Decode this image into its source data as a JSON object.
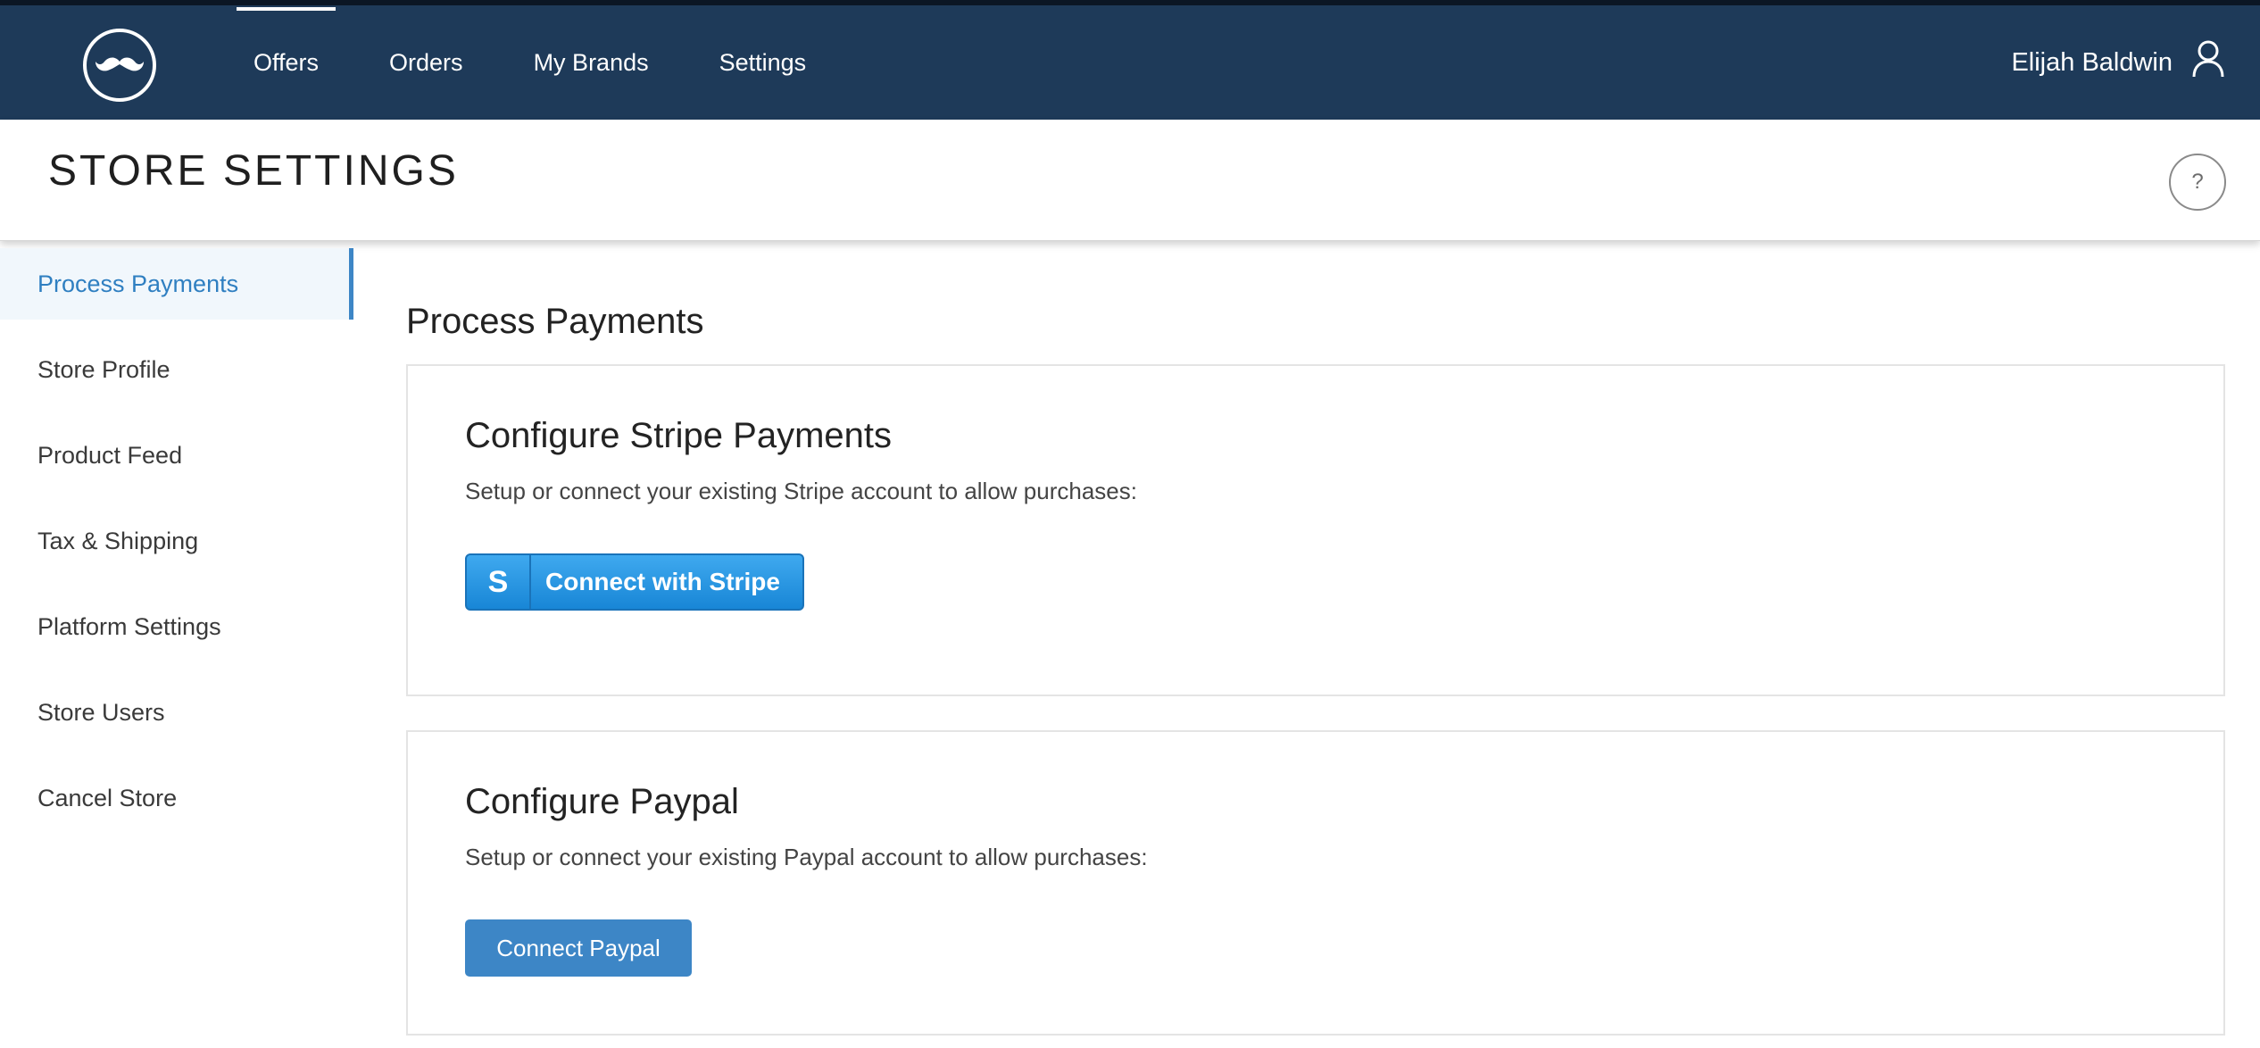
{
  "nav": {
    "items": [
      {
        "label": "Offers",
        "active": true
      },
      {
        "label": "Orders",
        "active": false
      },
      {
        "label": "My Brands",
        "active": false
      },
      {
        "label": "Settings",
        "active": false
      }
    ]
  },
  "user": {
    "name": "Elijah Baldwin"
  },
  "header": {
    "title": "STORE SETTINGS",
    "help": "?"
  },
  "sidebar": {
    "items": [
      {
        "label": "Process Payments",
        "active": true
      },
      {
        "label": "Store Profile",
        "active": false
      },
      {
        "label": "Product Feed",
        "active": false
      },
      {
        "label": "Tax & Shipping",
        "active": false
      },
      {
        "label": "Platform Settings",
        "active": false
      },
      {
        "label": "Store Users",
        "active": false
      },
      {
        "label": "Cancel Store",
        "active": false
      }
    ]
  },
  "main": {
    "title": "Process Payments",
    "stripe": {
      "heading": "Configure Stripe Payments",
      "description": "Setup or connect your existing Stripe account to allow purchases:",
      "button_icon": "S",
      "button_label": "Connect with Stripe"
    },
    "paypal": {
      "heading": "Configure Paypal",
      "description": "Setup or connect your existing Paypal account to allow purchases:",
      "button_label": "Connect Paypal"
    }
  },
  "colors": {
    "topbar": "#1e3a59",
    "accent": "#3d86c6",
    "active_sidebar_bg": "#f1f7fc"
  }
}
